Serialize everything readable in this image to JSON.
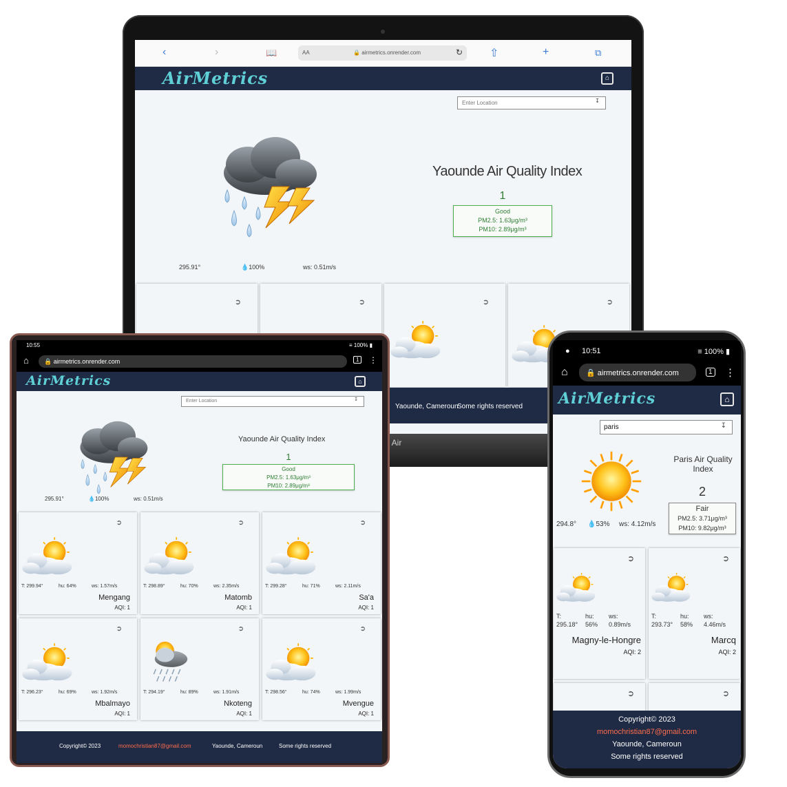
{
  "laptop": {
    "browser": {
      "aa_label": "AA",
      "url": "airmetrics.onrender.com",
      "back_icon": "chevron-left-icon",
      "forward_icon": "chevron-right-icon",
      "book_icon": "book-icon",
      "reload_icon": "reload-icon",
      "share_icon": "share-icon",
      "add_icon": "plus-icon",
      "tabs_icon": "tabs-icon"
    },
    "logo": "AirMetrics",
    "location_placeholder": "Enter Location",
    "title": "Yaounde Air Quality Index",
    "aqi": "1",
    "aqi_label": "Good",
    "pm25": "PM2.5: 1.63μg/m³",
    "pm10": "PM10: 2.89μg/m³",
    "temp": "295.91°",
    "humidity": "100%",
    "wind": "ws: 0.51m/s",
    "footer_location": "Yaounde, Cameroun",
    "footer_rights": "Some rights reserved",
    "base_label": "k Air"
  },
  "tablet": {
    "time": "10:55",
    "battery": "100%",
    "url": "airmetrics.onrender.com",
    "tab_count": "1",
    "logo": "AirMetrics",
    "location_placeholder": "Enter Location",
    "title": "Yaounde Air Quality Index",
    "aqi": "1",
    "aqi_label": "Good",
    "pm25": "PM2.5: 1.63μg/m³",
    "pm10": "PM10: 2.89μg/m³",
    "temp": "295.91°",
    "humidity": "100%",
    "wind": "ws: 0.51m/s",
    "cards": [
      {
        "t": "T: 299.94°",
        "hu": "hu: 64%",
        "ws": "ws: 1.57m/s",
        "name": "Mengang",
        "aqi": "AQI: 1"
      },
      {
        "t": "T: 298.89°",
        "hu": "hu: 70%",
        "ws": "ws: 2.35m/s",
        "name": "Matomb",
        "aqi": "AQI: 1"
      },
      {
        "t": "T: 299.28°",
        "hu": "hu: 71%",
        "ws": "ws: 2.11m/s",
        "name": "Sa'a",
        "aqi": "AQI: 1"
      },
      {
        "t": "T: 296.23°",
        "hu": "hu: 69%",
        "ws": "ws: 1.92m/s",
        "name": "Mbalmayo",
        "aqi": "AQI: 1"
      },
      {
        "t": "T: 294.19°",
        "hu": "hu: 89%",
        "ws": "ws: 1.91m/s",
        "name": "Nkoteng",
        "aqi": "AQI: 1"
      },
      {
        "t": "T: 298.56°",
        "hu": "hu: 74%",
        "ws": "ws: 1.99m/s",
        "name": "Mvengue",
        "aqi": "AQI: 1"
      }
    ],
    "footer": {
      "copyright": "Copyright© 2023",
      "email": "momochristian87@gmail.com",
      "location": "Yaounde, Cameroun",
      "rights": "Some rights reserved"
    }
  },
  "phone": {
    "time": "10:51",
    "battery": "100%",
    "url": "airmetrics.onrender.com",
    "tab_count": "1",
    "logo": "AirMetrics",
    "location_value": "paris",
    "title": "Paris Air Quality Index",
    "aqi": "2",
    "aqi_label": "Fair",
    "pm25": "PM2.5: 3.71μg/m³",
    "pm10": "PM10: 9.82μg/m³",
    "temp": "294.8°",
    "humidity": "53%",
    "wind": "ws: 4.12m/s",
    "cards": [
      {
        "t_label": "T:",
        "t": "295.18°",
        "hu_label": "hu:",
        "hu": "56%",
        "ws_label": "ws:",
        "ws": "0.89m/s",
        "name": "Magny-le-Hongre",
        "aqi": "AQI: 2"
      },
      {
        "t_label": "T:",
        "t": "293.73°",
        "hu_label": "hu:",
        "hu": "58%",
        "ws_label": "ws:",
        "ws": "4.46m/s",
        "name": "Marcq",
        "aqi": "AQI: 2"
      }
    ],
    "footer": {
      "copyright": "Copyright© 2023",
      "email": "momochristian87@gmail.com",
      "location": "Yaounde, Cameroun",
      "rights": "Some rights reserved"
    }
  },
  "colors": {
    "navy": "#1f2a44",
    "teal_logo": "#5fd0d6",
    "aqi_green": "#2e7d32",
    "email_orange": "#ff6d4d"
  }
}
